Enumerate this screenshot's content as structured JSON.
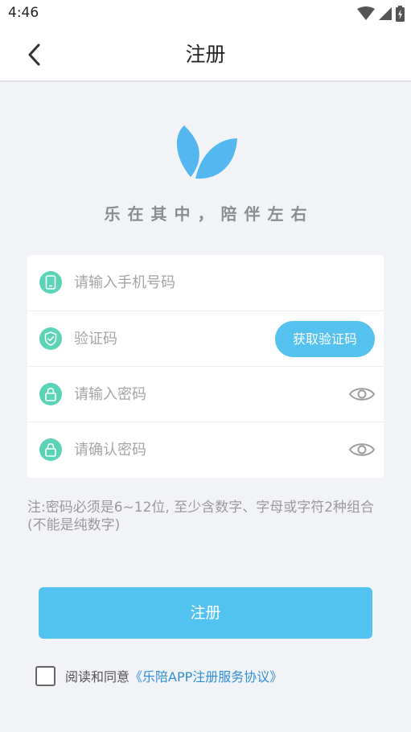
{
  "status": {
    "time": "4:46"
  },
  "header": {
    "title": "注册"
  },
  "brand": {
    "slogan": "乐在其中，陪伴左右",
    "accent": "#55b7f0"
  },
  "form": {
    "phone": {
      "placeholder": "请输入手机号码",
      "value": ""
    },
    "code": {
      "placeholder": "验证码",
      "value": "",
      "button_label": "获取验证码"
    },
    "password": {
      "placeholder": "请输入密码",
      "value": ""
    },
    "confirm": {
      "placeholder": "请确认密码",
      "value": ""
    }
  },
  "note": "注:密码必须是6~12位, 至少含数字、字母或字符2种组合(不能是纯数字)",
  "register_label": "注册",
  "agreement": {
    "prefix": "阅读和同意",
    "link": "《乐陪APP注册服务协议》",
    "checked": false
  },
  "icons": {
    "back": "chevron-left-icon",
    "phone": "phone-icon",
    "code": "shield-check-icon",
    "password": "lock-icon",
    "eye": "eye-icon"
  },
  "colors": {
    "button": "#52c3f1",
    "icon_bg": "#5ad3b6",
    "link": "#2f8fd9"
  }
}
